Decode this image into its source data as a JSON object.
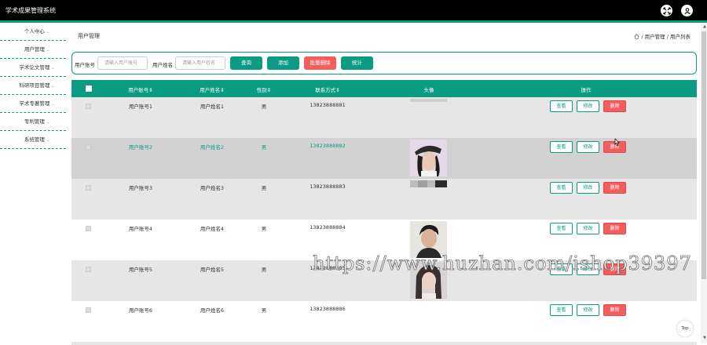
{
  "app": {
    "title": "学术成果管理系统"
  },
  "colors": {
    "accent": "#0a9b82",
    "danger": "#f25d5d",
    "topbar": "#000000"
  },
  "topbar_icons": [
    "fullscreen-icon",
    "user-icon"
  ],
  "sidebar": {
    "items": [
      {
        "label": "个人中心"
      },
      {
        "label": "用户管理"
      },
      {
        "label": "学术论文管理"
      },
      {
        "label": "科研项目管理"
      },
      {
        "label": "学术专著管理"
      },
      {
        "label": "专利管理"
      },
      {
        "label": "系统管理"
      }
    ]
  },
  "page": {
    "title": "用户管理",
    "breadcrumb": "/ 用户管理 / 用户列表"
  },
  "search": {
    "account_label": "用户账号",
    "account_placeholder": "请输入用户账号",
    "name_label": "用户姓名",
    "name_placeholder": "请输入用户姓名",
    "query_button": "查询",
    "add_button": "添加",
    "batch_delete_button": "批量删除",
    "stats_button": "统计"
  },
  "table": {
    "headers": {
      "account": "用户账号⇕",
      "name": "用户姓名⇕",
      "gender": "性别⇕",
      "phone": "联系方式⇕",
      "avatar": "头像",
      "ops": "操作"
    },
    "actions": {
      "view": "查看",
      "edit": "修改",
      "delete": "删除"
    },
    "rows": [
      {
        "account": "用户账号1",
        "name": "用户姓名1",
        "gender": "男",
        "phone": "13823888881"
      },
      {
        "account": "用户账号2",
        "name": "用户姓名2",
        "gender": "男",
        "phone": "13823888882"
      },
      {
        "account": "用户账号3",
        "name": "用户姓名3",
        "gender": "男",
        "phone": "13823888883"
      },
      {
        "account": "用户账号4",
        "name": "用户姓名4",
        "gender": "男",
        "phone": "13823888884"
      },
      {
        "account": "用户账号5",
        "name": "用户姓名5",
        "gender": "男",
        "phone": "13823888885"
      },
      {
        "account": "用户账号6",
        "name": "用户姓名6",
        "gender": "男",
        "phone": "13823888886"
      }
    ]
  },
  "top_button": "Top",
  "watermark": "https://www.huzhan.com/ishop39397"
}
